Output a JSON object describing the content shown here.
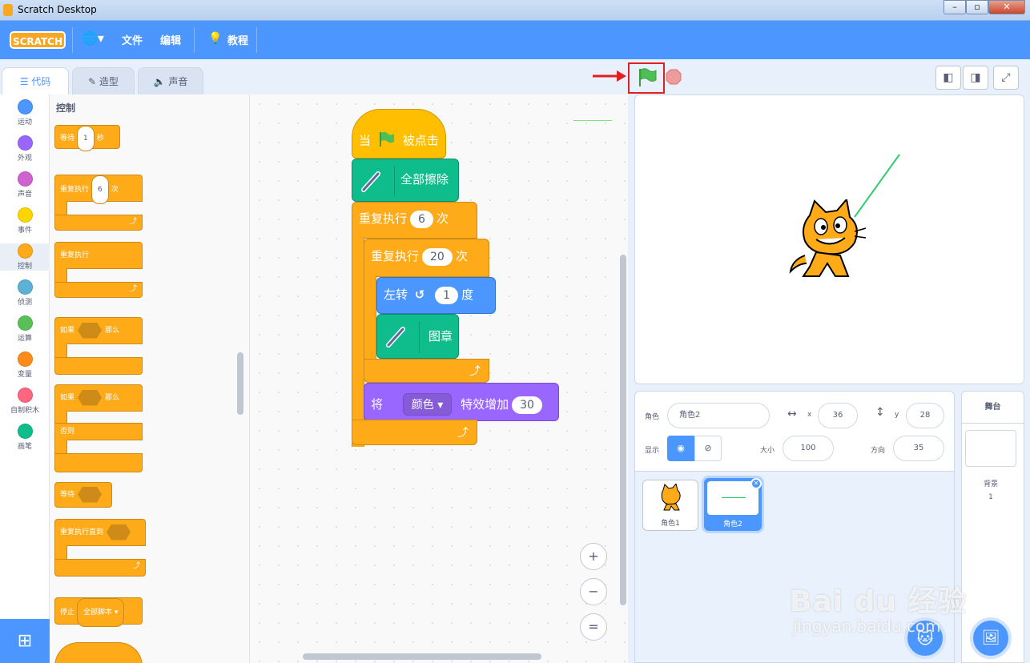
{
  "window": {
    "title": "Scratch Desktop"
  },
  "menu": {
    "logo": "SCRATCH",
    "file": "文件",
    "edit": "编辑",
    "tutorials": "教程"
  },
  "tabs": {
    "code": "代码",
    "costumes": "造型",
    "sounds": "声音"
  },
  "categories": [
    {
      "label": "运动",
      "color": "#4c97ff"
    },
    {
      "label": "外观",
      "color": "#9966ff"
    },
    {
      "label": "声音",
      "color": "#cf63cf"
    },
    {
      "label": "事件",
      "color": "#ffd500"
    },
    {
      "label": "控制",
      "color": "#ffab19"
    },
    {
      "label": "侦测",
      "color": "#5cb1d6"
    },
    {
      "label": "运算",
      "color": "#59c059"
    },
    {
      "label": "变量",
      "color": "#ff8c1a"
    },
    {
      "label": "自制积木",
      "color": "#ff6680"
    },
    {
      "label": "画笔",
      "color": "#0fbd8c"
    }
  ],
  "palette": {
    "heading": "控制",
    "wait": "等待",
    "wait_val": "1",
    "wait_unit": "秒",
    "repeat": "重复执行",
    "repeat_val": "6",
    "repeat_unit": "次",
    "forever": "重复执行",
    "if": "如果",
    "then": "那么",
    "if2": "如果",
    "then2": "那么",
    "else": "否则",
    "wait_until": "等待",
    "repeat_until": "重复执行直到",
    "stop": "停止",
    "stop_opt": "全部脚本 ▾"
  },
  "script": {
    "hat_when": "当",
    "hat_clicked": "被点击",
    "erase_all": "全部擦除",
    "repeat_outer": "重复执行",
    "repeat_outer_val": "6",
    "repeat_outer_unit": "次",
    "repeat_inner": "重复执行",
    "repeat_inner_val": "20",
    "repeat_inner_unit": "次",
    "turn_left": "左转",
    "turn_val": "1",
    "turn_unit": "度",
    "stamp": "图章",
    "change_effect_a": "将",
    "change_effect_opt": "颜色",
    "change_effect_b": "特效增加",
    "change_effect_val": "30"
  },
  "zoom": {
    "in": "+",
    "out": "−",
    "reset": "="
  },
  "sprite_info": {
    "sprite_label": "角色",
    "sprite_name": "角色2",
    "x_label": "x",
    "x_val": "36",
    "y_label": "y",
    "y_val": "28",
    "show_label": "显示",
    "size_label": "大小",
    "size_val": "100",
    "direction_label": "方向",
    "direction_val": "35"
  },
  "sprites": [
    {
      "name": "角色1"
    },
    {
      "name": "角色2"
    }
  ],
  "stage_panel": {
    "title": "舞台",
    "backdrops_label": "背景",
    "backdrops_count": "1"
  },
  "watermark": {
    "logo": "Bai du 经验",
    "url": "jingyan.baidu.com"
  },
  "colors": {
    "accent": "#4c97ff",
    "control": "#ffab19",
    "pen": "#0fbd8c",
    "motion": "#4c97ff",
    "looks": "#9966ff",
    "highlight": "#e02020"
  }
}
